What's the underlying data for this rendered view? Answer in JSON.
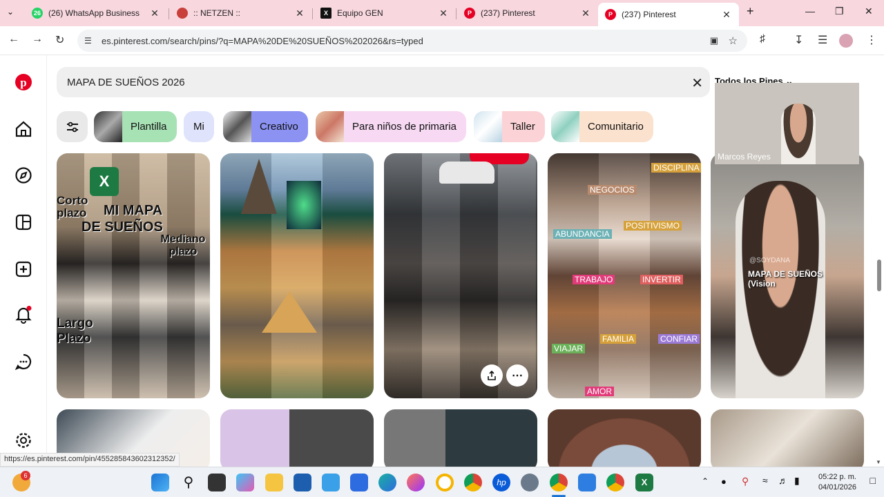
{
  "browser": {
    "tabs": [
      {
        "title": "(26) WhatsApp Business",
        "color": "#25d366",
        "glyph": "26"
      },
      {
        "title": ":: NETZEN ::",
        "color": "#c9403a",
        "glyph": ""
      },
      {
        "title": "Equipo GEN",
        "color": "#111111",
        "glyph": "X"
      },
      {
        "title": "(237) Pinterest",
        "color": "#e60023",
        "glyph": "P"
      },
      {
        "title": "(237) Pinterest",
        "color": "#e60023",
        "glyph": "P"
      }
    ],
    "url": "es.pinterest.com/search/pins/?q=MAPA%20DE%20SUEÑOS%202026&rs=typed"
  },
  "search": {
    "query": "MAPA DE SUEÑOS 2026",
    "filter_label": "Todos los Pines"
  },
  "chips": [
    {
      "label": "Plantilla",
      "color": "#a7e2b5"
    },
    {
      "label": "Mi",
      "color": "#dfe3fb"
    },
    {
      "label": "Creativo",
      "color": "#8b92f2"
    },
    {
      "label": "Para niños de primaria",
      "color": "#f7d9f3"
    },
    {
      "label": "Taller",
      "color": "#fbd3d6"
    },
    {
      "label": "Comunitario",
      "color": "#fbe2cf"
    }
  ],
  "pins": {
    "p1": {
      "line1": "MI MAPA",
      "line2": "DE SUEÑOS",
      "corto": "Corto plazo",
      "mediano": "Mediano plazo",
      "largo": "Largo Plazo"
    },
    "p4": {
      "tags": [
        "DISCIPLINA",
        "NEGOCIOS",
        "POSITIVISMO",
        "ABUNDANCIA",
        "TRABAJO",
        "INVERTIR",
        "FAMILIA",
        "CONFIAR",
        "VIAJAR",
        "AMOR"
      ]
    },
    "p5": {
      "caption": "MAPA DE SUEÑOS (Vision",
      "handle": "@SOYDANA"
    }
  },
  "video_call": {
    "name": "Marcos Reyes"
  },
  "status_url": "https://es.pinterest.com/pin/455285843602312352/",
  "clock": {
    "time": "05:22 p. m.",
    "date": "04/01/2026"
  },
  "taskbar": {
    "notif_badge": "6"
  }
}
